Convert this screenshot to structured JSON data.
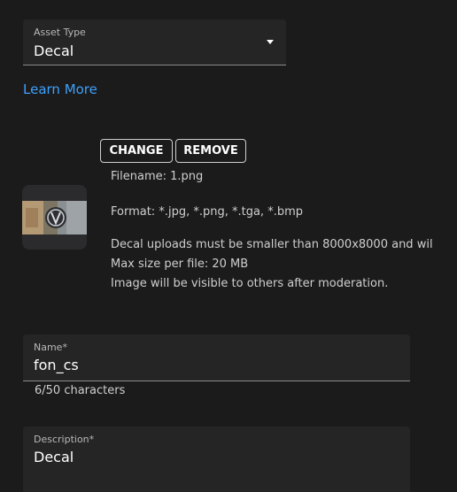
{
  "asset_type": {
    "label": "Asset Type",
    "value": "Decal"
  },
  "learn_more": "Learn More",
  "buttons": {
    "change": "CHANGE",
    "remove": "REMOVE"
  },
  "file_info": {
    "filename": "Filename: 1.png",
    "format": "Format: *.jpg, *.png, *.tga, *.bmp",
    "size_limit": "Decal uploads must be smaller than 8000x8000 and wil",
    "max_size": "Max size per file: 20 MB",
    "moderation": "Image will be visible to others after moderation."
  },
  "name_field": {
    "label": "Name*",
    "value": "fon_cs",
    "char_count": "6/50 characters"
  },
  "description_field": {
    "label": "Description*",
    "value": "Decal"
  },
  "colors": {
    "background": "#1b1b1c",
    "field_bg": "#252526",
    "link": "#3da1ff"
  }
}
